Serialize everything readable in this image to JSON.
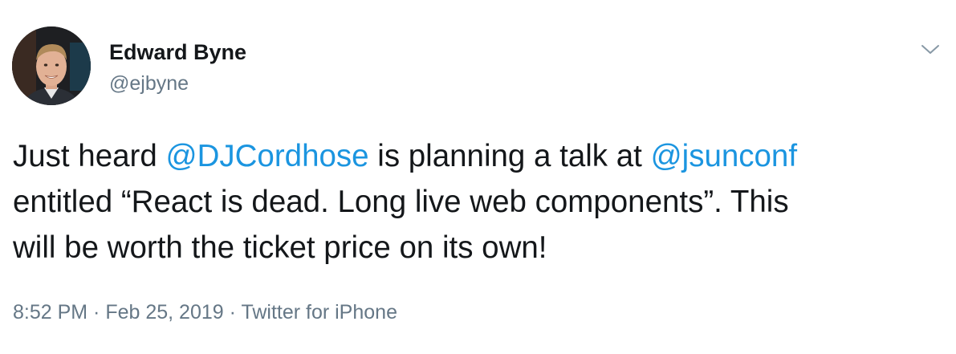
{
  "author": {
    "name": "Edward Byne",
    "handle": "@ejbyne"
  },
  "menu": {
    "icon": "chevron-down-icon"
  },
  "tweet": {
    "line1": {
      "pre": "Just heard ",
      "mention1": "@DJCordhose",
      "mid": " is planning a talk at ",
      "mention2": "@jsunconf"
    },
    "line2": "entitled “React is dead. Long live web components”. This",
    "line3": "will be worth the ticket price on its own!"
  },
  "meta": {
    "time": "8:52 PM",
    "sep1": " · ",
    "date": "Feb 25, 2019",
    "sep2": " · ",
    "source": "Twitter for iPhone"
  },
  "colors": {
    "text": "#14171a",
    "secondary": "#657786",
    "link": "#1b95e0"
  }
}
